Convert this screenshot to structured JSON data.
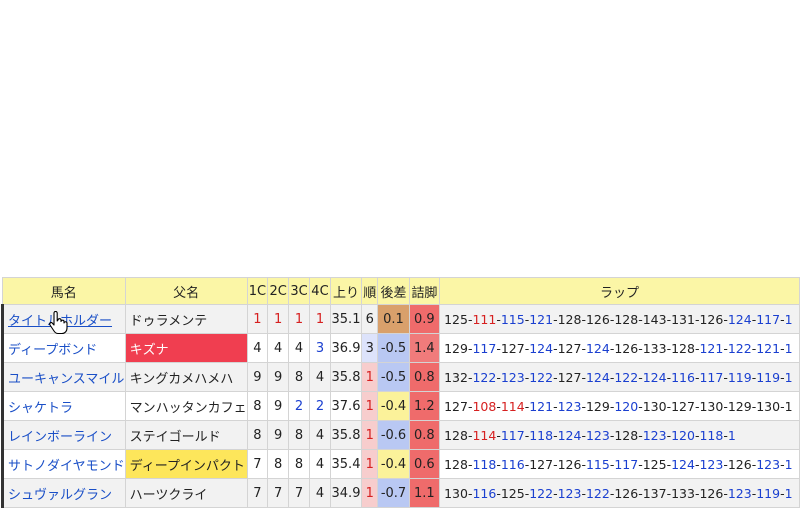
{
  "headers": {
    "horse": "馬名",
    "sire": "父名",
    "c1": "1C",
    "c2": "2C",
    "c3": "3C",
    "c4": "4C",
    "last": "上り",
    "rank": "順",
    "diff": "後差",
    "kick": "詰脚",
    "lap": "ラップ"
  },
  "colors": {
    "header_bg": "#fbf6a6",
    "red": "#d62020",
    "blue": "#1a3fd0"
  },
  "rows": [
    {
      "horse": "タイトルホルダー",
      "sire": "ドゥラメンテ",
      "c1": "1",
      "c2": "1",
      "c3": "1",
      "c4": "1",
      "last": "35.1",
      "rank": "6",
      "diff": "0.1",
      "kick": "0.9",
      "laps": [
        [
          "125",
          "blk"
        ],
        [
          "111",
          "red"
        ],
        [
          "115",
          "blue"
        ],
        [
          "121",
          "blue"
        ],
        [
          "128",
          "blk"
        ],
        [
          "126",
          "blk"
        ],
        [
          "128",
          "blk"
        ],
        [
          "143",
          "blk"
        ],
        [
          "131",
          "blk"
        ],
        [
          "126",
          "blk"
        ],
        [
          "124",
          "blue"
        ],
        [
          "117",
          "blue"
        ],
        [
          "1",
          "blue"
        ]
      ]
    },
    {
      "horse": "ディープボンド",
      "sire": "キズナ",
      "c1": "4",
      "c2": "4",
      "c3": "4",
      "c4": "3",
      "last": "36.9",
      "rank": "3",
      "diff": "-0.5",
      "kick": "1.4",
      "laps": [
        [
          "129",
          "blk"
        ],
        [
          "117",
          "blue"
        ],
        [
          "127",
          "blk"
        ],
        [
          "124",
          "blue"
        ],
        [
          "127",
          "blk"
        ],
        [
          "124",
          "blue"
        ],
        [
          "126",
          "blk"
        ],
        [
          "133",
          "blk"
        ],
        [
          "128",
          "blk"
        ],
        [
          "121",
          "blue"
        ],
        [
          "122",
          "blue"
        ],
        [
          "121",
          "blue"
        ],
        [
          "1",
          "blue"
        ]
      ]
    },
    {
      "horse": "ユーキャンスマイル",
      "sire": "キングカメハメハ",
      "c1": "9",
      "c2": "9",
      "c3": "8",
      "c4": "4",
      "last": "35.8",
      "rank": "1",
      "diff": "-0.5",
      "kick": "0.8",
      "laps": [
        [
          "132",
          "blk"
        ],
        [
          "122",
          "blue"
        ],
        [
          "123",
          "blue"
        ],
        [
          "122",
          "blue"
        ],
        [
          "127",
          "blk"
        ],
        [
          "124",
          "blue"
        ],
        [
          "122",
          "blue"
        ],
        [
          "124",
          "blue"
        ],
        [
          "116",
          "blue"
        ],
        [
          "117",
          "blue"
        ],
        [
          "119",
          "blue"
        ],
        [
          "119",
          "blue"
        ],
        [
          "1",
          "blue"
        ]
      ]
    },
    {
      "horse": "シャケトラ",
      "sire": "マンハッタンカフェ",
      "c1": "8",
      "c2": "9",
      "c3": "2",
      "c4": "2",
      "last": "37.6",
      "rank": "1",
      "diff": "-0.4",
      "kick": "1.2",
      "laps": [
        [
          "127",
          "blk"
        ],
        [
          "108",
          "red"
        ],
        [
          "114",
          "red"
        ],
        [
          "121",
          "blue"
        ],
        [
          "123",
          "blue"
        ],
        [
          "129",
          "blk"
        ],
        [
          "120",
          "blue"
        ],
        [
          "130",
          "blk"
        ],
        [
          "127",
          "blk"
        ],
        [
          "130",
          "blk"
        ],
        [
          "129",
          "blk"
        ],
        [
          "130",
          "blk"
        ],
        [
          "1",
          "blk"
        ]
      ]
    },
    {
      "horse": "レインボーライン",
      "sire": "ステイゴールド",
      "c1": "8",
      "c2": "9",
      "c3": "8",
      "c4": "4",
      "last": "35.8",
      "rank": "1",
      "diff": "-0.6",
      "kick": "0.8",
      "laps": [
        [
          "128",
          "blk"
        ],
        [
          "114",
          "red"
        ],
        [
          "117",
          "blue"
        ],
        [
          "118",
          "blue"
        ],
        [
          "124",
          "blue"
        ],
        [
          "123",
          "blue"
        ],
        [
          "128",
          "blk"
        ],
        [
          "123",
          "blue"
        ],
        [
          "120",
          "blue"
        ],
        [
          "118",
          "blue"
        ],
        [
          "1",
          "blue"
        ]
      ]
    },
    {
      "horse": "サトノダイヤモンド",
      "sire": "ディープインパクト",
      "c1": "7",
      "c2": "8",
      "c3": "8",
      "c4": "4",
      "last": "35.4",
      "rank": "1",
      "diff": "-0.4",
      "kick": "0.6",
      "laps": [
        [
          "128",
          "blk"
        ],
        [
          "118",
          "blue"
        ],
        [
          "116",
          "blue"
        ],
        [
          "127",
          "blk"
        ],
        [
          "126",
          "blk"
        ],
        [
          "115",
          "blue"
        ],
        [
          "117",
          "blue"
        ],
        [
          "125",
          "blk"
        ],
        [
          "124",
          "blue"
        ],
        [
          "123",
          "blue"
        ],
        [
          "126",
          "blk"
        ],
        [
          "123",
          "blue"
        ],
        [
          "1",
          "blue"
        ]
      ]
    },
    {
      "horse": "シュヴァルグラン",
      "sire": "ハーツクライ",
      "c1": "7",
      "c2": "7",
      "c3": "7",
      "c4": "4",
      "last": "34.9",
      "rank": "1",
      "diff": "-0.7",
      "kick": "1.1",
      "laps": [
        [
          "130",
          "blk"
        ],
        [
          "116",
          "blue"
        ],
        [
          "125",
          "blk"
        ],
        [
          "122",
          "blue"
        ],
        [
          "123",
          "blue"
        ],
        [
          "122",
          "blue"
        ],
        [
          "126",
          "blk"
        ],
        [
          "137",
          "blk"
        ],
        [
          "133",
          "blk"
        ],
        [
          "126",
          "blk"
        ],
        [
          "123",
          "blue"
        ],
        [
          "119",
          "blue"
        ],
        [
          "1",
          "blue"
        ]
      ]
    }
  ],
  "row_styles": [
    {
      "sire_bg": "",
      "sire_color": "",
      "c_colors": [
        "red",
        "red",
        "red",
        "red"
      ],
      "rank_bg": "",
      "diff_bg": "#d9a06b",
      "kick_bg": "#ef6b6b",
      "bg": "#f2f2f2"
    },
    {
      "sire_bg": "#f03e50",
      "sire_color": "#ffffff",
      "c_colors": [
        "blk",
        "blk",
        "blk",
        "blue"
      ],
      "rank_bg": "#dde3fb",
      "diff_bg": "#b9c8f3",
      "kick_bg": "#f07b7b",
      "bg": "#ffffff"
    },
    {
      "sire_bg": "",
      "sire_color": "",
      "c_colors": [
        "blk",
        "blk",
        "blk",
        "blk"
      ],
      "rank_bg": "#f7cdcd",
      "diff_bg": "#b9c8f3",
      "kick_bg": "#ef6b6b",
      "bg": "#f2f2f2"
    },
    {
      "sire_bg": "",
      "sire_color": "",
      "c_colors": [
        "blk",
        "blk",
        "blue",
        "blue"
      ],
      "rank_bg": "#f7cdcd",
      "diff_bg": "#fbf29a",
      "kick_bg": "#ef6b6b",
      "bg": "#ffffff"
    },
    {
      "sire_bg": "",
      "sire_color": "",
      "c_colors": [
        "blk",
        "blk",
        "blk",
        "blk"
      ],
      "rank_bg": "#f7cdcd",
      "diff_bg": "#b9c8f3",
      "kick_bg": "#ef6b6b",
      "bg": "#f2f2f2"
    },
    {
      "sire_bg": "#fde65b",
      "sire_color": "#222222",
      "c_colors": [
        "blk",
        "blk",
        "blk",
        "blk"
      ],
      "rank_bg": "#f7cdcd",
      "diff_bg": "#fbf29a",
      "kick_bg": "#ef6b6b",
      "bg": "#ffffff"
    },
    {
      "sire_bg": "",
      "sire_color": "",
      "c_colors": [
        "blk",
        "blk",
        "blk",
        "blk"
      ],
      "rank_bg": "#f7cdcd",
      "diff_bg": "#b9c8f3",
      "kick_bg": "#ef6b6b",
      "bg": "#f2f2f2"
    }
  ]
}
